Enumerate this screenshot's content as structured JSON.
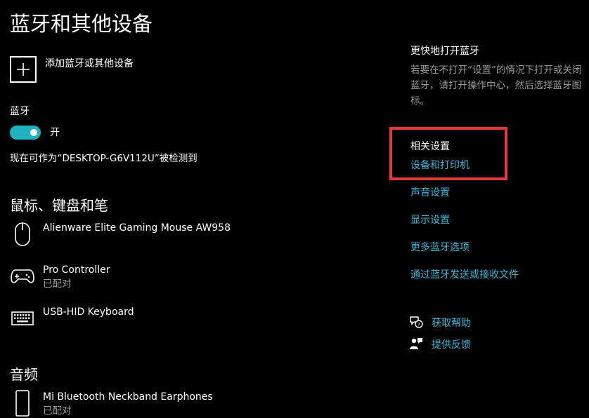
{
  "page": {
    "title": "蓝牙和其他设备"
  },
  "add_device": {
    "label": "添加蓝牙或其他设备"
  },
  "bluetooth": {
    "label": "蓝牙",
    "toggle_state": "开",
    "discoverable_text": "现在可作为“DESKTOP-G6V112U”被检测到",
    "toggle_color": "#1fb3bf"
  },
  "sections": {
    "mouse_keyboard_pen": {
      "heading": "鼠标、键盘和笔",
      "devices": [
        {
          "name": "Alienware Elite Gaming Mouse AW958",
          "status": "",
          "icon": "mouse-icon"
        },
        {
          "name": "Pro Controller",
          "status": "已配对",
          "icon": "gamepad-icon"
        },
        {
          "name": "USB-HID Keyboard",
          "status": "",
          "icon": "keyboard-icon"
        }
      ]
    },
    "audio": {
      "heading": "音频",
      "devices": [
        {
          "name": "Mi Bluetooth Neckband Earphones",
          "status": "已配对",
          "icon": "phone-device-icon"
        }
      ]
    }
  },
  "sidebar": {
    "quick_open": {
      "heading": "更快地打开蓝牙",
      "description": "若要在不打开“设置”的情况下打开或关闭蓝牙，请打开操作中心，然后选择蓝牙图标。"
    },
    "related": {
      "heading": "相关设置",
      "links": [
        "设备和打印机",
        "声音设置",
        "显示设置",
        "更多蓝牙选项",
        "通过蓝牙发送或接收文件"
      ]
    },
    "help": {
      "get_help": "获取帮助",
      "feedback": "提供反馈"
    }
  },
  "colors": {
    "background": "#000000",
    "link": "#3ab8d8",
    "highlight_box": "#e53935",
    "secondary_text": "#9a9a9a"
  }
}
